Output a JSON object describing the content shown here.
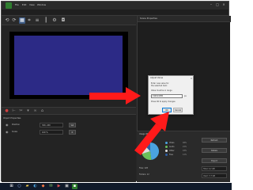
{
  "menu": [
    "File",
    "Edit",
    "View",
    "Window"
  ],
  "tabs": [
    "",
    "",
    ""
  ],
  "right_panel": {
    "title": "Scene Properties"
  },
  "properties": {
    "header": "Object Properties",
    "rows": [
      {
        "label": "Position",
        "value": "320, 240",
        "button": "Set"
      },
      {
        "label": "Scale",
        "value": "100 %",
        "button": "⚙"
      }
    ]
  },
  "dialog": {
    "title": "Adjust Value",
    "lines": [
      "Enter new value for",
      "the selected item:"
    ],
    "note": "Value must be in range",
    "input_value": "1920x1080",
    "unit": "px",
    "hint": "Press OK to apply changes",
    "ok": "OK",
    "cancel": "Cancel"
  },
  "stats": {
    "title": "Usage Statistics",
    "legend": [
      {
        "label": "Video",
        "value": "48%",
        "color": "#4aa3df"
      },
      {
        "label": "Audio",
        "value": "22%",
        "color": "#6bbf59"
      },
      {
        "label": "Other",
        "value": "18%",
        "color": "#e0e0e0"
      },
      {
        "label": "Free",
        "value": "12%",
        "color": "#2d5fa6"
      }
    ],
    "buttons": [
      "Refresh",
      "Details",
      "Export"
    ],
    "fields": [
      "Total: 4.2 GB",
      "Used: 3.7 GB"
    ],
    "lines": [
      "Files: 128",
      "Folders: 12"
    ]
  },
  "colors": {
    "viewport": "#2c2a86",
    "arrow": "#ff1a1a"
  }
}
